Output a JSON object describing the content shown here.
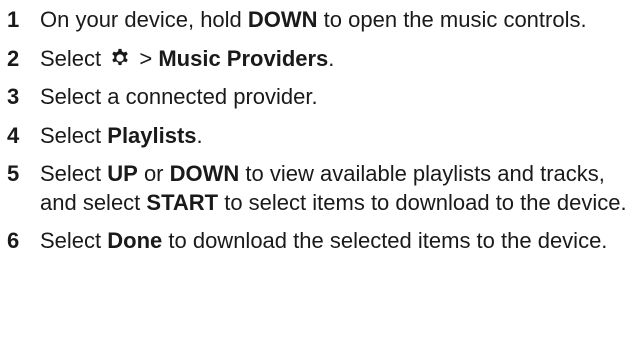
{
  "clipped_heading": "",
  "steps": [
    {
      "number": "1",
      "parts": [
        "On your device, hold ",
        "DOWN",
        " to open the music controls."
      ]
    },
    {
      "number": "2",
      "parts": [
        "Select ",
        " > ",
        "Music Providers",
        "."
      ],
      "icon": "gear-icon"
    },
    {
      "number": "3",
      "parts": [
        "Select a connected provider."
      ]
    },
    {
      "number": "4",
      "parts": [
        "Select ",
        "Playlists",
        "."
      ]
    },
    {
      "number": "5",
      "parts": [
        "Select ",
        "UP",
        " or ",
        "DOWN",
        " to view available playlists and tracks, and select ",
        "START",
        " to select items to download to the device."
      ]
    },
    {
      "number": "6",
      "parts": [
        "Select ",
        "Done",
        " to download the selected items to the device."
      ]
    }
  ]
}
